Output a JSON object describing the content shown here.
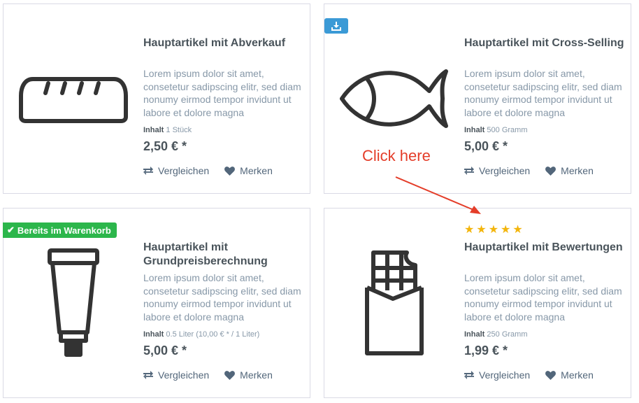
{
  "products": [
    {
      "title": "Hauptartikel mit Abverkauf",
      "description": "Lorem ipsum dolor sit amet, consetetur sadipscing elitr, sed diam nonumy eirmod tempor invidunt ut labore et dolore magna",
      "content_label": "Inhalt",
      "content_value": "1 Stück",
      "price": "2,50 € *",
      "icon": "bread-icon"
    },
    {
      "title": "Hauptartikel mit Cross-Selling",
      "description": "Lorem ipsum dolor sit amet, consetetur sadipscing elitr, sed diam nonumy eirmod tempor invidunt ut labore et dolore magna",
      "content_label": "Inhalt",
      "content_value": "500 Gramm",
      "price": "5,00 € *",
      "icon": "fish-icon",
      "badge_icon": "download-icon"
    },
    {
      "title": "Hauptartikel mit Grundpreisberechnung",
      "description": "Lorem ipsum dolor sit amet, consetetur sadipscing elitr, sed diam nonumy eirmod tempor invidunt ut labore et dolore magna",
      "content_label": "Inhalt",
      "content_value": "0.5 Liter (10,00 € * / 1 Liter)",
      "price": "5,00 € *",
      "icon": "tube-icon",
      "badge": "Bereits im Warenkorb"
    },
    {
      "title": "Hauptartikel mit Bewertungen",
      "description": "Lorem ipsum dolor sit amet, consetetur sadipscing elitr, sed diam nonumy eirmod tempor invidunt ut labore et dolore magna",
      "content_label": "Inhalt",
      "content_value": "250 Gramm",
      "price": "1,99 € *",
      "icon": "chocolate-icon",
      "rating": 5
    }
  ],
  "actions": {
    "compare_label": "Vergleichen",
    "wishlist_label": "Merken"
  },
  "annotation": {
    "text": "Click here",
    "color": "#e43d29"
  },
  "colors": {
    "badge_download": "#3b9ad6",
    "badge_cart": "#2cb64b",
    "stars": "#f3b50c",
    "icon_stroke": "#333333"
  }
}
